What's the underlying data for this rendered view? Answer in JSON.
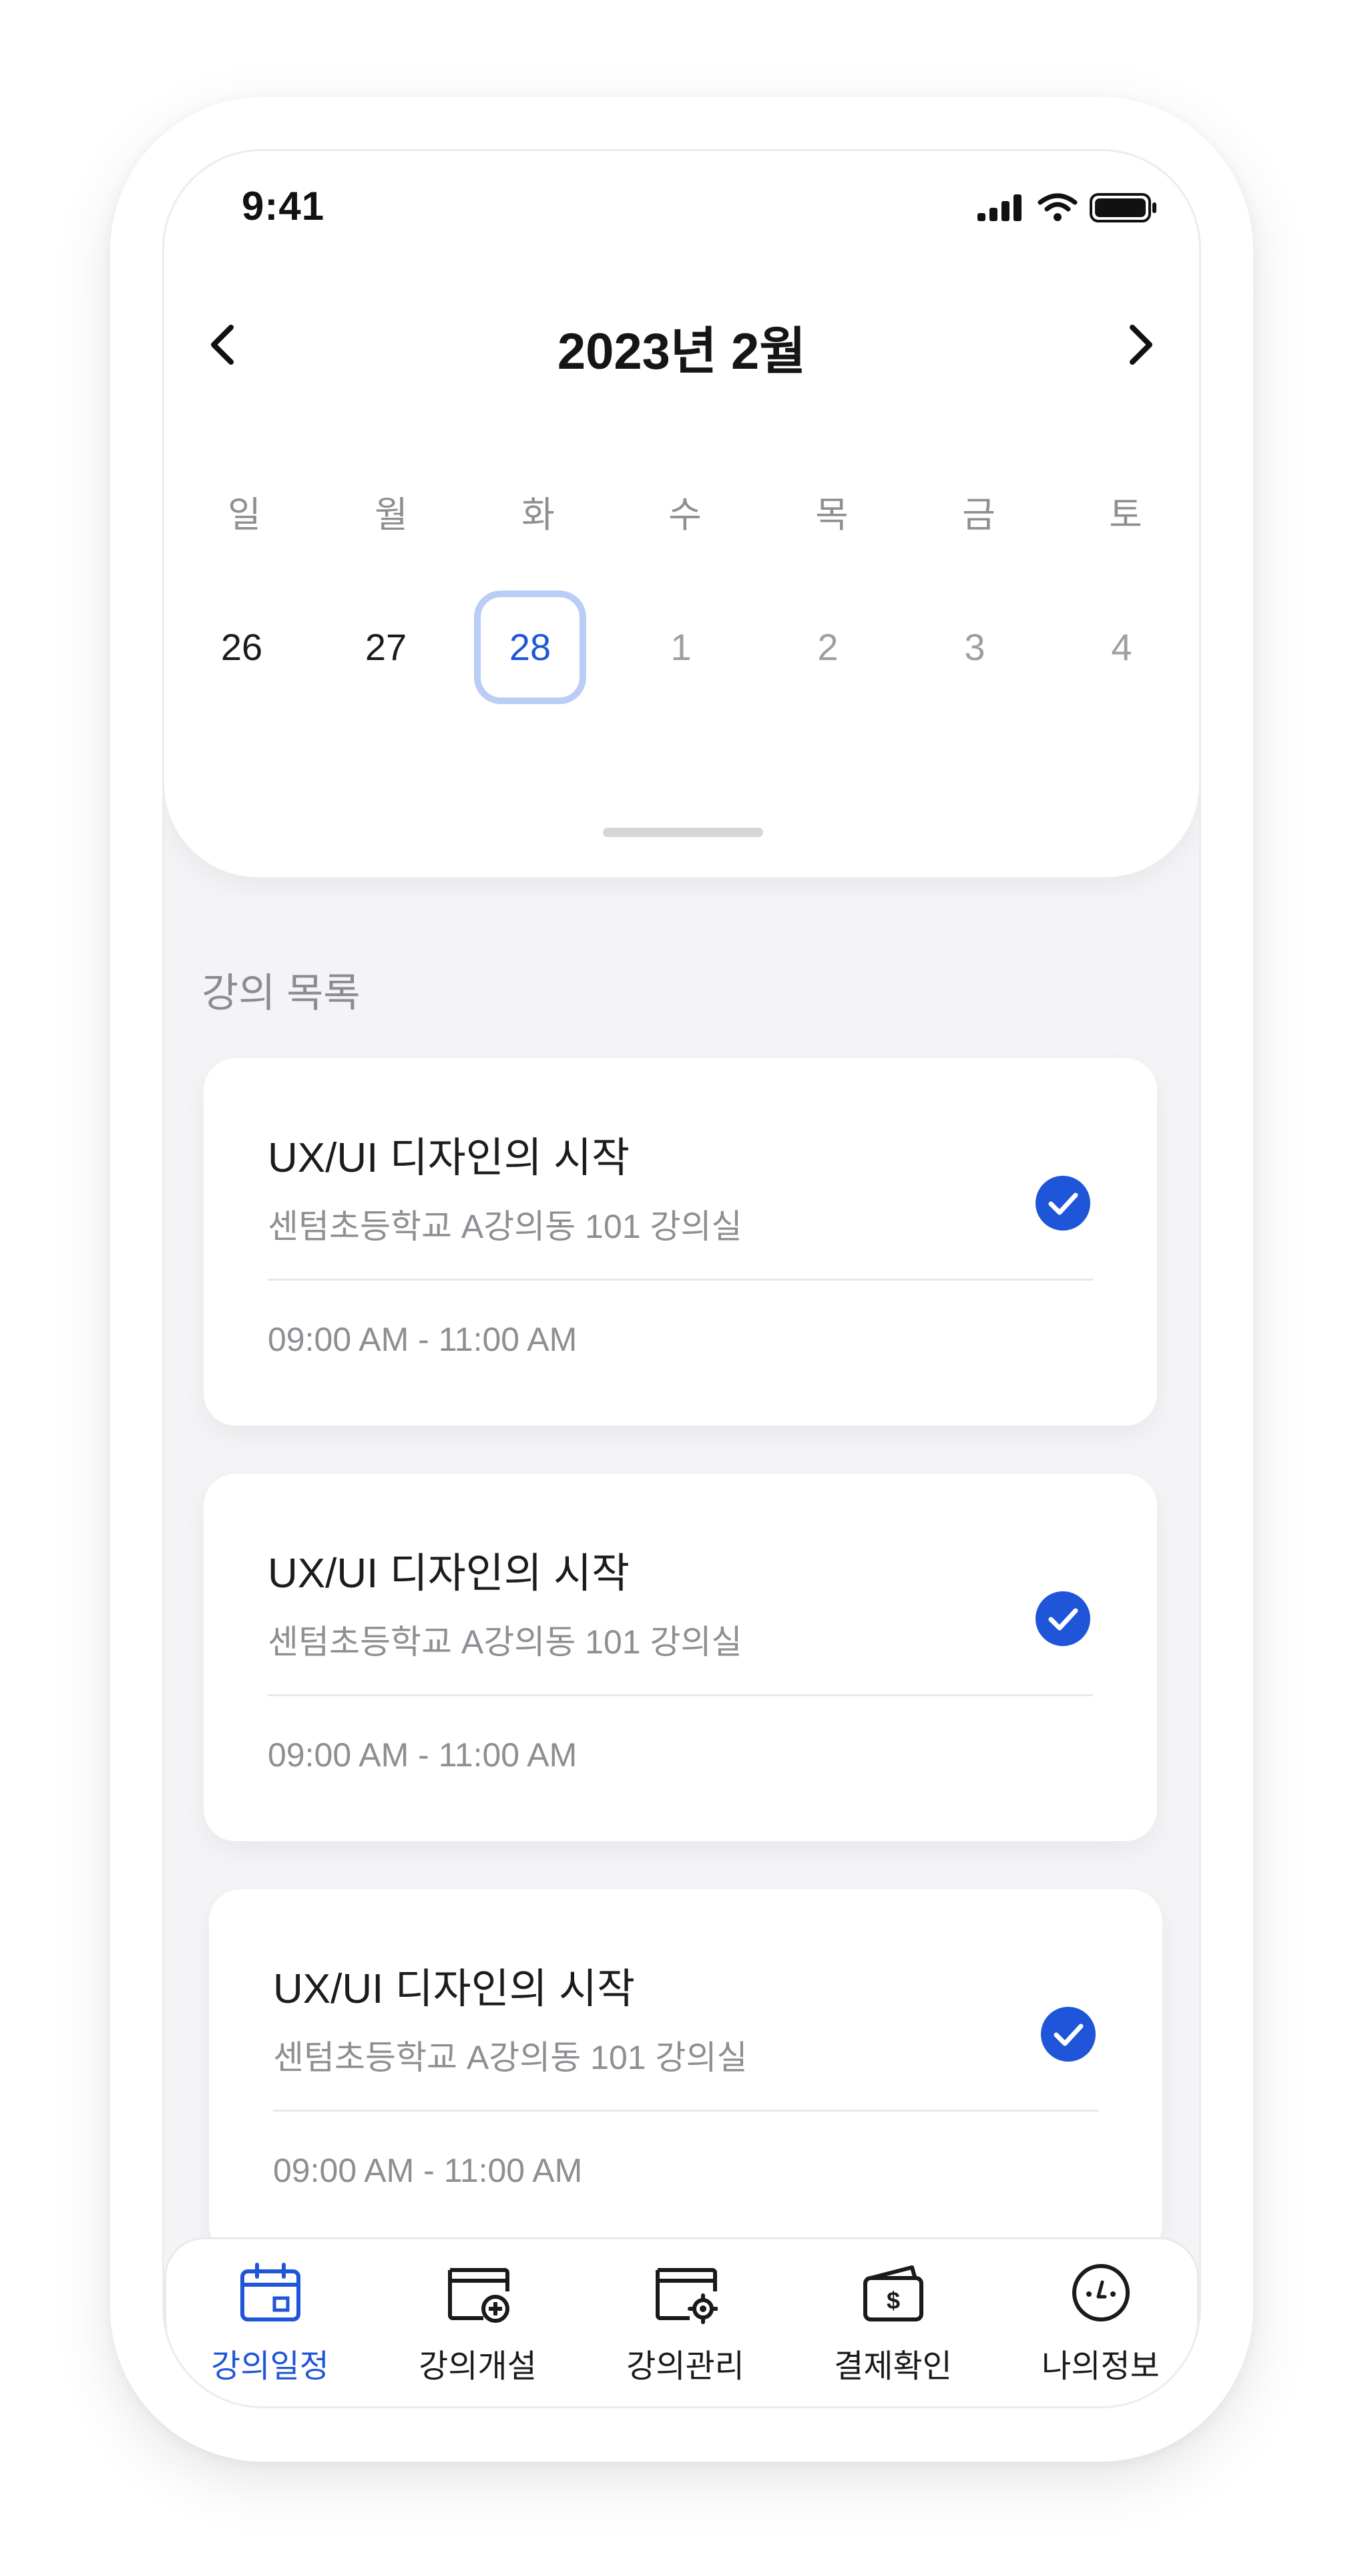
{
  "status_bar": {
    "time": "9:41"
  },
  "calendar": {
    "title": "2023년 2월",
    "weekdays": [
      "일",
      "월",
      "화",
      "수",
      "목",
      "금",
      "토"
    ],
    "dates": [
      "26",
      "27",
      "28",
      "1",
      "2",
      "3",
      "4"
    ],
    "selected_date": "28"
  },
  "section": {
    "title": "강의 목록"
  },
  "lectures": [
    {
      "title": "UX/UI 디자인의 시작",
      "location": "센텀초등학교 A강의동 101 강의실",
      "time": "09:00 AM - 11:00 AM",
      "checked": true
    },
    {
      "title": "UX/UI 디자인의 시작",
      "location": "센텀초등학교 A강의동 101 강의실",
      "time": "09:00 AM - 11:00 AM",
      "checked": true
    },
    {
      "title": "UX/UI 디자인의 시작",
      "location": "센텀초등학교 A강의동 101 강의실",
      "time": "09:00 AM - 11:00 AM",
      "checked": true
    }
  ],
  "tabbar": {
    "items": [
      {
        "label": "강의일정",
        "icon": "calendar-icon",
        "active": true
      },
      {
        "label": "강의개설",
        "icon": "folder-add-icon",
        "active": false
      },
      {
        "label": "강의관리",
        "icon": "folder-settings-icon",
        "active": false
      },
      {
        "label": "결제확인",
        "icon": "wallet-icon",
        "active": false
      },
      {
        "label": "나의정보",
        "icon": "profile-icon",
        "active": false
      }
    ]
  },
  "colors": {
    "accent": "#1f55d8",
    "selected_border": "#b9cdf6",
    "muted_text": "#8e8e93",
    "background": "#f4f4f7"
  }
}
